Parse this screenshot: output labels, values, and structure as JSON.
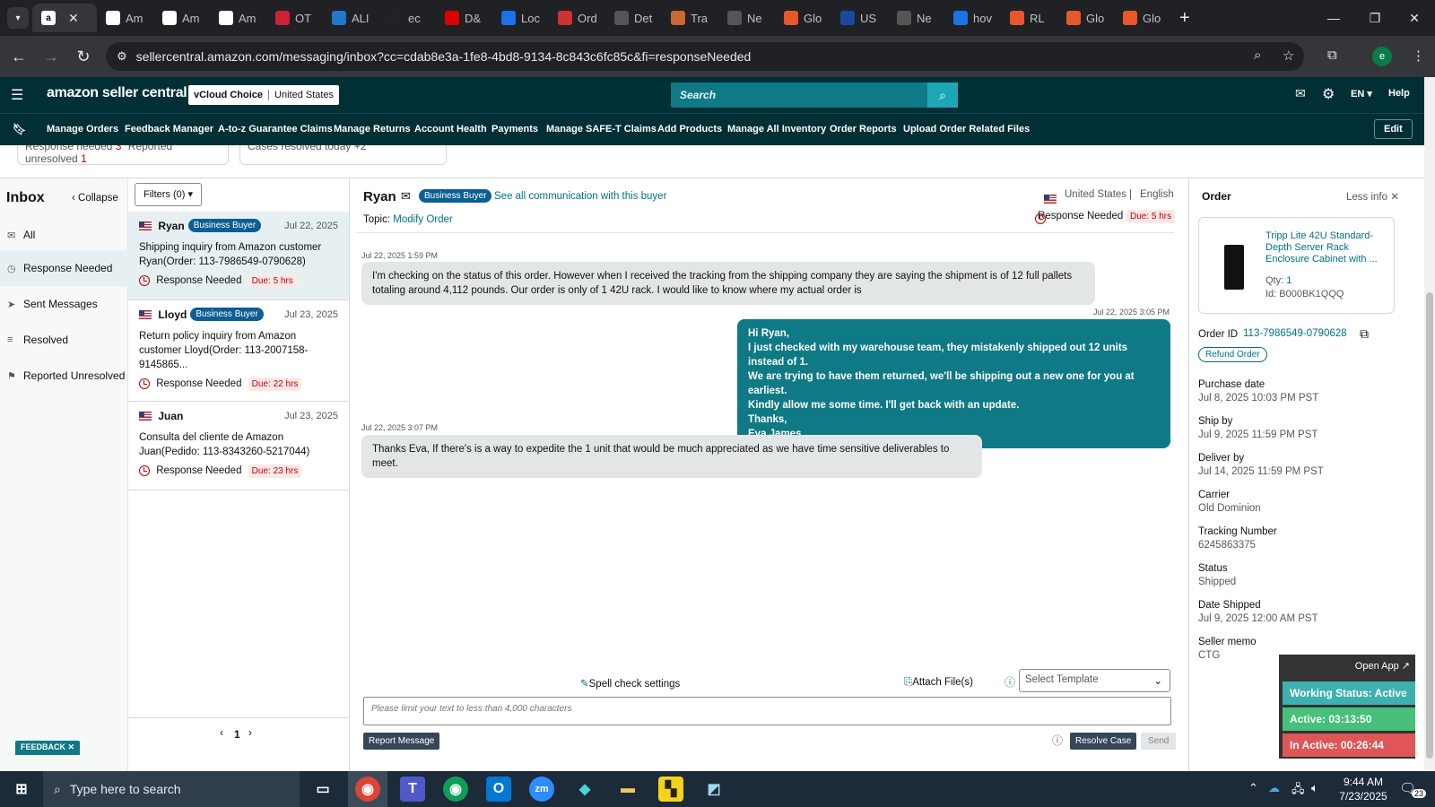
{
  "browser": {
    "active_tab_title": "Am",
    "tabs": [
      "Am",
      "Am",
      "Am",
      "Am",
      "OT",
      "ALI",
      "ec",
      "D&",
      "Loc",
      "Ord",
      "Det",
      "Tra",
      "Ne",
      "Glo",
      "US",
      "Ne",
      "hov",
      "RL",
      "Glo",
      "Glo"
    ],
    "url": "sellercentral.amazon.com/messaging/inbox?cc=cdab8e3a-1fe8-4bd8-9134-8c843c6fc85c&fi=responseNeeded",
    "profile_initial": "e"
  },
  "header": {
    "logo": "amazon seller central",
    "account": "vCloud Choice",
    "marketplace": "United States",
    "search_placeholder": "Search",
    "lang": "EN",
    "help": "Help"
  },
  "nav": {
    "items": [
      "Manage Orders",
      "Feedback Manager",
      "A-to-z Guarantee Claims",
      "Manage Returns",
      "Account Health",
      "Payments",
      "Manage SAFE-T Claims",
      "Add Products",
      "Manage All Inventory",
      "Order Reports",
      "Upload Order Related Files"
    ],
    "edit": "Edit"
  },
  "stats": {
    "response_needed_label": "Response needed",
    "response_needed_count": "3",
    "reported_unresolved_label": "Reported unresolved",
    "reported_unresolved_count": "1",
    "resolved_today": "Cases resolved today +2"
  },
  "inbox": {
    "title": "Inbox",
    "collapse": "Collapse",
    "items": [
      "All",
      "Response Needed",
      "Sent Messages",
      "Resolved",
      "Reported Unresolved"
    ],
    "filters": "Filters (0)"
  },
  "conversations": [
    {
      "name": "Ryan",
      "badge": "Business Buyer",
      "date": "Jul 22, 2025",
      "subject": "Shipping inquiry from Amazon customer Ryan(Order: 113-7986549-0790628)",
      "status": "Response Needed",
      "due": "Due: 5 hrs"
    },
    {
      "name": "Lloyd",
      "badge": "Business Buyer",
      "date": "Jul 23, 2025",
      "subject": "Return policy inquiry from Amazon customer Lloyd(Order: 113-2007158-9145865...",
      "status": "Response Needed",
      "due": "Due: 22 hrs"
    },
    {
      "name": "Juan",
      "badge": "",
      "date": "Jul 23, 2025",
      "subject": "Consulta del cliente de Amazon Juan(Pedido: 113-8343260-5217044)",
      "status": "Response Needed",
      "due": "Due: 23 hrs"
    }
  ],
  "pagination": {
    "page": "1"
  },
  "feedback": "FEEDBACK",
  "thread": {
    "buyer": "Ryan",
    "badge": "Business Buyer",
    "see_all": "See all communication with this buyer",
    "country": "United States",
    "language": "English",
    "topic_label": "Topic:",
    "topic": "Modify Order",
    "status": "Response Needed",
    "due": "Due: 5 hrs",
    "messages": [
      {
        "time": "Jul 22, 2025 1:59 PM",
        "lines": [
          "I'm checking on the status of this order. However when I received the tracking from the shipping company they are saying the shipment is of 12 full pallets",
          "totaling around 4,112 pounds. Our order is only of 1 42U rack. I would like to know where my actual order is"
        ]
      },
      {
        "time": "Jul 22, 2025 3:05 PM",
        "lines": [
          "Hi Ryan,",
          "I just checked with my warehouse team, they mistakenly shipped out 12 units instead of 1.",
          "We are trying to have them returned, we'll be shipping out a new one for you at earliest.",
          "Kindly allow me some time. I'll get back with an update.",
          "Thanks,",
          "Eva James."
        ]
      },
      {
        "time": "Jul 22, 2025 3:07 PM",
        "lines": [
          "Thanks Eva, If there's is a way to expedite the 1 unit that would be much appreciated as we have time sensitive deliverables to meet."
        ]
      }
    ],
    "spell_check": "Spell check settings",
    "attach": "Attach File(s)",
    "template_placeholder": "Select Template",
    "reply_placeholder": "Please limit your text to less than 4,000 characters",
    "report": "Report Message",
    "resolve": "Resolve Case",
    "send": "Send"
  },
  "order": {
    "title": "Order",
    "less_info": "Less info",
    "product": "Tripp Lite 42U Standard-Depth Server Rack Enclosure Cabinet with ...",
    "qty_label": "Qty:",
    "qty": "1",
    "id_label": "Id:",
    "asin": "B000BK1QQQ",
    "order_id_label": "Order ID",
    "order_id": "113-7986549-0790628",
    "refund": "Refund Order",
    "fields": [
      {
        "label": "Purchase date",
        "value": "Jul 8, 2025 10:03 PM PST"
      },
      {
        "label": "Ship by",
        "value": "Jul 9, 2025 11:59 PM PST"
      },
      {
        "label": "Deliver by",
        "value": "Jul 14, 2025 11:59 PM PST"
      },
      {
        "label": "Carrier",
        "value": "Old Dominion"
      },
      {
        "label": "Tracking Number",
        "value": "6245863375"
      },
      {
        "label": "Status",
        "value": "Shipped"
      },
      {
        "label": "Date Shipped",
        "value": "Jul 9, 2025 12:00 AM PST"
      },
      {
        "label": "Seller memo",
        "value": "CTG"
      }
    ]
  },
  "widget": {
    "open_app": "Open App ↗",
    "working": "Working Status: Active",
    "active": "Active: 03:13:50",
    "inactive": "In Active: 00:26:44"
  },
  "taskbar": {
    "search": "Type here to search",
    "time": "9:44 AM",
    "date": "7/23/2025",
    "notif_count": "23"
  }
}
